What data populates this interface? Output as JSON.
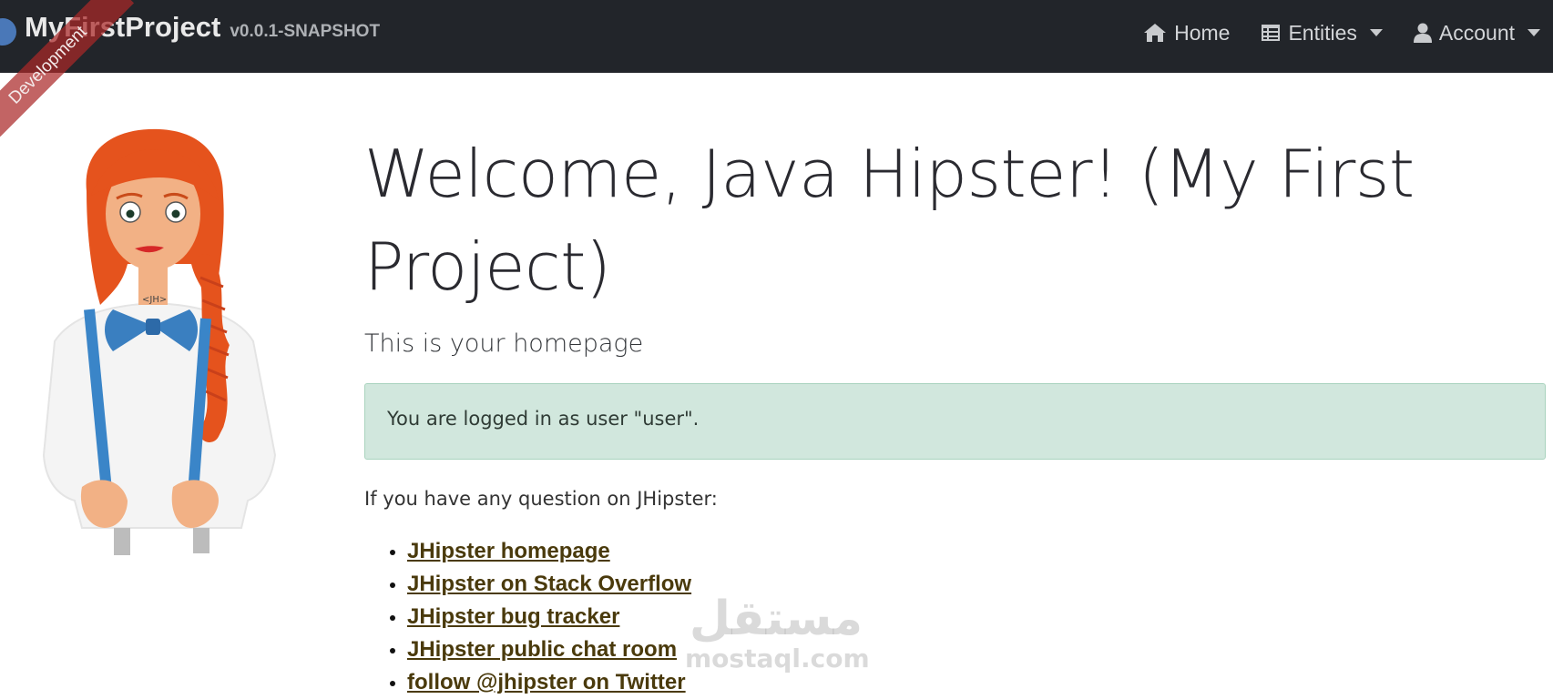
{
  "navbar": {
    "brand_title": "MyFirstProject",
    "brand_version": "v0.0.1-SNAPSHOT",
    "ribbon": "Development",
    "items": [
      {
        "label": "Home",
        "icon": "home-icon"
      },
      {
        "label": "Entities",
        "icon": "table-icon",
        "dropdown": true
      },
      {
        "label": "Account",
        "icon": "user-icon",
        "dropdown": true
      }
    ]
  },
  "main": {
    "title": "Welcome, Java Hipster! (My First Project)",
    "subtitle": "This is your homepage",
    "alert": "You are logged in as user \"user\".",
    "question": "If you have any question on JHipster:",
    "links": [
      "JHipster homepage",
      "JHipster on Stack Overflow",
      "JHipster bug tracker",
      "JHipster public chat room",
      "follow @jhipster on Twitter"
    ]
  },
  "watermark": {
    "arabic": "مستقل",
    "latin": "mostaql.com"
  },
  "colors": {
    "navbar_bg": "#22252a",
    "alert_bg": "#d1e7dd",
    "link": "#4a3a0c",
    "ribbon": "#aa2828"
  }
}
